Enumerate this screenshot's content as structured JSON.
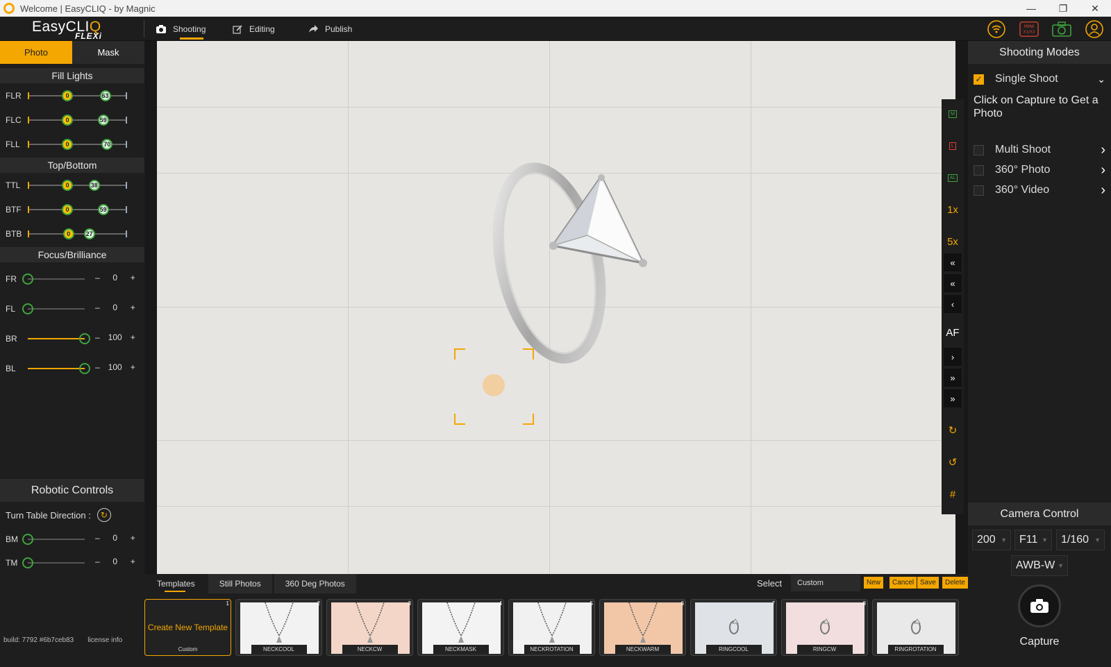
{
  "window": {
    "title": "Welcome | EasyCLIQ - by Magnic",
    "minimize": "—",
    "maximize": "❐",
    "close": "✕"
  },
  "logo": {
    "text": "EasyCLI",
    "q": "Q",
    "sub": "FLEXi"
  },
  "nav": {
    "tabs": [
      {
        "label": "Shooting",
        "icon": "camera-icon"
      },
      {
        "label": "Editing",
        "icon": "edit-icon"
      },
      {
        "label": "Publish",
        "icon": "share-icon"
      }
    ],
    "right_icons": [
      "wifi-icon",
      "mini-x1x3-icon",
      "camera-status-icon",
      "user-account-icon"
    ],
    "mini_text": "MINI",
    "mini_sub": "X1/X3"
  },
  "left": {
    "mode_tabs": [
      "Photo",
      "Mask"
    ],
    "fill_lights": {
      "title": "Fill Lights",
      "rows": [
        {
          "label": "FLR",
          "low": "0",
          "high": "63",
          "low_frac": 0.4,
          "high_frac": 0.78
        },
        {
          "label": "FLC",
          "low": "0",
          "high": "59",
          "low_frac": 0.4,
          "high_frac": 0.76
        },
        {
          "label": "FLL",
          "low": "0",
          "high": "70",
          "low_frac": 0.4,
          "high_frac": 0.8
        }
      ]
    },
    "top_bottom": {
      "title": "Top/Bottom",
      "rows": [
        {
          "label": "TTL",
          "low": "0",
          "high": "38",
          "low_frac": 0.4,
          "high_frac": 0.67
        },
        {
          "label": "BTF",
          "low": "0",
          "high": "59",
          "low_frac": 0.4,
          "high_frac": 0.76
        },
        {
          "label": "BTB",
          "low": "0",
          "high": "27",
          "low_frac": 0.41,
          "high_frac": 0.62
        }
      ]
    },
    "focus": {
      "title": "Focus/Brilliance",
      "rows": [
        {
          "label": "FR",
          "value": "0",
          "frac": 0.0
        },
        {
          "label": "FL",
          "value": "0",
          "frac": 0.0
        },
        {
          "label": "BR",
          "value": "100",
          "frac": 1.0
        },
        {
          "label": "BL",
          "value": "100",
          "frac": 1.0
        }
      ]
    },
    "robotic": {
      "title": "Robotic Controls",
      "turntable_label": "Turn Table Direction :",
      "rows": [
        {
          "label": "BM",
          "value": "0",
          "frac": 0.0
        },
        {
          "label": "TM",
          "value": "0",
          "frac": 0.0
        }
      ]
    },
    "minus": "–",
    "plus": "+",
    "build": "build: 7792 #6b7ceb83",
    "license": "license info"
  },
  "viewer": {
    "side_buttons": [
      {
        "label": "M",
        "kind": "icon",
        "name": "mode-m-button"
      },
      {
        "label": "L",
        "kind": "icon",
        "name": "mode-l-button"
      },
      {
        "label": "AL",
        "kind": "icon",
        "name": "mode-al-button"
      },
      {
        "label": "1x",
        "kind": "text",
        "name": "zoom-1x-button"
      },
      {
        "label": "5x",
        "kind": "text",
        "name": "zoom-5x-button"
      },
      {
        "label": "«",
        "kind": "dark",
        "name": "focus-far-3-button"
      },
      {
        "label": "«",
        "kind": "dark",
        "name": "focus-far-2-button"
      },
      {
        "label": "‹",
        "kind": "dark",
        "name": "focus-far-1-button"
      },
      {
        "label": "AF",
        "kind": "af",
        "name": "autofocus-button"
      },
      {
        "label": "›",
        "kind": "dark",
        "name": "focus-near-1-button"
      },
      {
        "label": "»",
        "kind": "dark",
        "name": "focus-near-2-button"
      },
      {
        "label": "»",
        "kind": "dark",
        "name": "focus-near-3-button"
      },
      {
        "label": "↻",
        "kind": "text",
        "name": "rotate-cw-button"
      },
      {
        "label": "↺",
        "kind": "text",
        "name": "rotate-ccw-button"
      },
      {
        "label": "#",
        "kind": "text",
        "name": "grid-toggle-button"
      }
    ]
  },
  "bottom": {
    "tabs": [
      "Templates",
      "Still Photos",
      "360 Deg Photos"
    ],
    "select_label": "Select",
    "select_value": "Custom",
    "actions": [
      "New",
      "Cancel",
      "Save",
      "Delete"
    ],
    "create": {
      "title": "Create New Template",
      "tag": "Custom",
      "num": "1"
    },
    "templates": [
      {
        "num": "2",
        "tag": "NECKCOOL",
        "bg": "#f2f2f2"
      },
      {
        "num": "3",
        "tag": "NECKCW",
        "bg": "#f4d6c8"
      },
      {
        "num": "4",
        "tag": "NECKMASK",
        "bg": "#f3f3f3"
      },
      {
        "num": "5",
        "tag": "NECKROTATION",
        "bg": "#f1f1f1"
      },
      {
        "num": "6",
        "tag": "NECKWARM",
        "bg": "#f1c7a8"
      },
      {
        "num": "7",
        "tag": "RINGCOOL",
        "bg": "#dfe3e8"
      },
      {
        "num": "8",
        "tag": "RINGCW",
        "bg": "#f2dede"
      },
      {
        "num": "",
        "tag": "RINGROTATION",
        "bg": "#e9e9e9"
      }
    ]
  },
  "right": {
    "title": "Shooting Modes",
    "single": {
      "label": "Single Shoot",
      "checked": true
    },
    "desc": "Click on Capture to Get a Photo",
    "modes": [
      {
        "label": "Multi Shoot"
      },
      {
        "label": "360° Photo"
      },
      {
        "label": "360° Video"
      }
    ],
    "camera": {
      "title": "Camera Control",
      "iso": "200",
      "aperture": "F11",
      "shutter": "1/160",
      "wb": "AWB-W"
    },
    "capture_label": "Capture"
  },
  "colors": {
    "accent": "#f4a700",
    "panel": "#1e1e1e",
    "knob_ring": "#3fa33f"
  }
}
